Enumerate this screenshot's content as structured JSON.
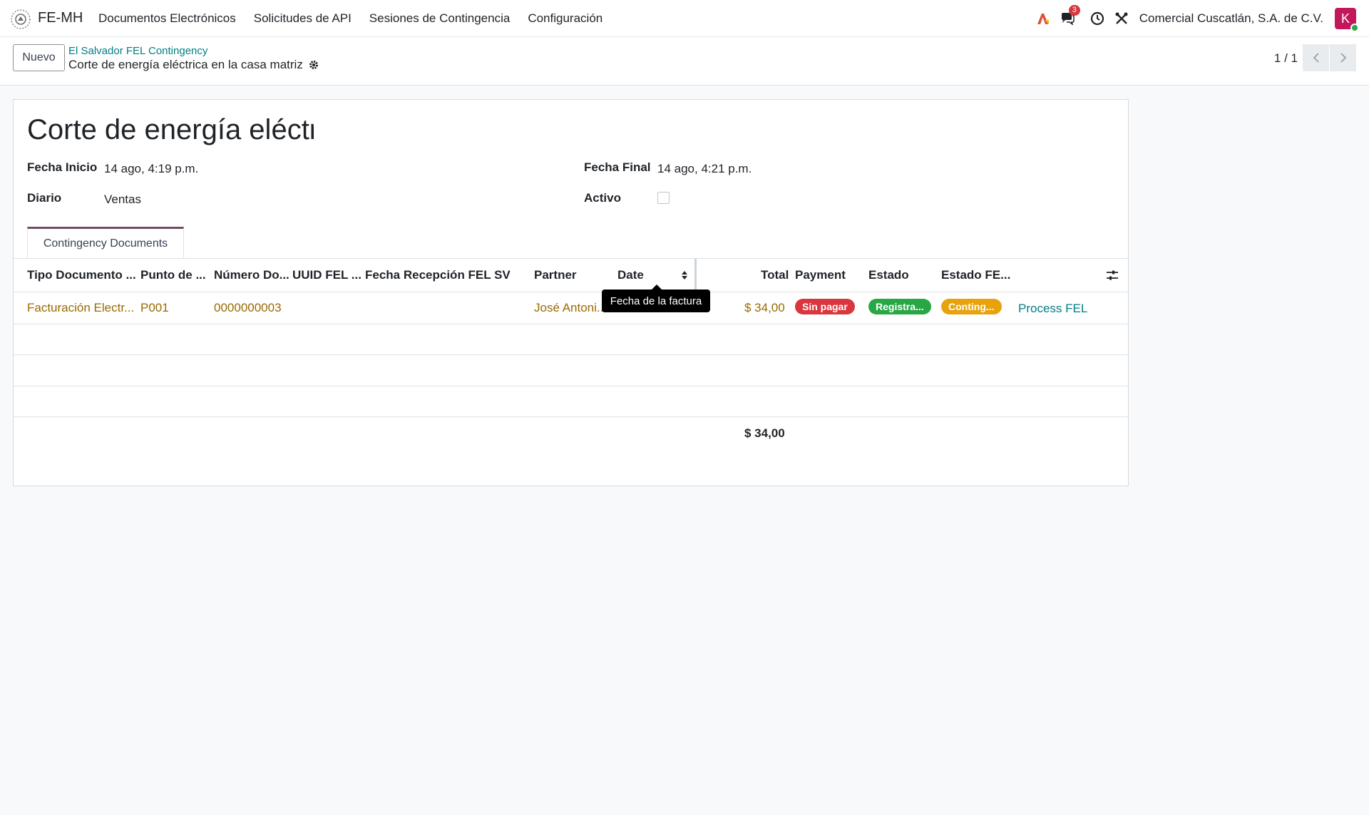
{
  "navbar": {
    "app_name": "FE-MH",
    "menu": [
      "Documentos Electrónicos",
      "Solicitudes de API",
      "Sesiones de Contingencia",
      "Configuración"
    ],
    "messages_badge": "3",
    "company": "Comercial Cuscatlán, S.A. de C.V.",
    "avatar_initial": "K"
  },
  "control": {
    "new_button": "Nuevo",
    "breadcrumb_parent": "El Salvador FEL Contingency",
    "breadcrumb_current": "Corte de energía eléctrica en la casa matriz",
    "pager": "1 / 1"
  },
  "form": {
    "title": "Corte de energía eléctri",
    "fecha_inicio_label": "Fecha Inicio",
    "fecha_inicio_value": "14 ago, 4:19 p.m.",
    "fecha_final_label": "Fecha Final",
    "fecha_final_value": "14 ago, 4:21 p.m.",
    "diario_label": "Diario",
    "diario_value": "Ventas",
    "activo_label": "Activo",
    "activo_checked": false,
    "tab_label": "Contingency Documents"
  },
  "table": {
    "headers": [
      "Tipo Documento ...",
      "Punto de ...",
      "Número Do...",
      "UUID FEL ...",
      "Fecha Recepción FEL SV",
      "Partner",
      "Date",
      "Total",
      "Payment",
      "Estado",
      "Estado FE..."
    ],
    "rows": [
      {
        "tipo": "Facturación Electr...",
        "punto": "P001",
        "numero": "0000000003",
        "uuid": "",
        "fecha_recepcion": "",
        "partner": "José Antoni...",
        "date": "",
        "total": "$ 34,00",
        "payment": "Sin pagar",
        "estado": "Registra...",
        "estado_fel": "Conting...",
        "action": "Process FEL"
      }
    ],
    "footer_total": "$ 34,00",
    "tooltip": "Fecha de la factura"
  },
  "colors": {
    "accent": "#714b67",
    "link": "#017e84",
    "payment_pill": "#d9363e",
    "estado_pill": "#28a745",
    "estado_fel_pill": "#e8a20c"
  }
}
